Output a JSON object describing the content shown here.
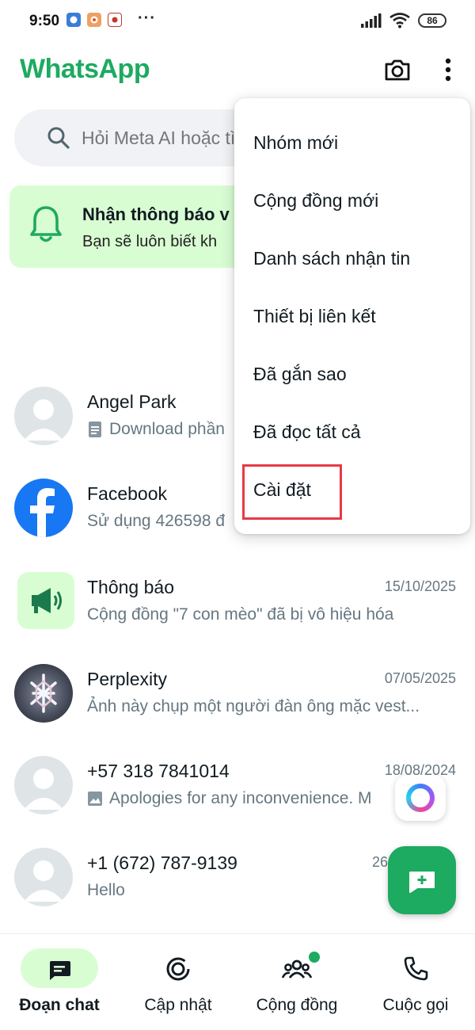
{
  "status_bar": {
    "time": "9:50",
    "battery": "86",
    "more_dots": "···"
  },
  "header": {
    "title": "WhatsApp",
    "camera_icon": "camera-icon",
    "more_icon": "more-vertical-icon"
  },
  "search": {
    "placeholder": "Hỏi Meta AI hoặc tìm kiếm"
  },
  "notice": {
    "title": "Nhận thông báo v",
    "text": "Bạn sẽ luôn biết kh"
  },
  "chats": [
    {
      "name": "Angel Park",
      "preview": "Download phần",
      "date": "",
      "preview_icon": "document-icon",
      "avatar": "default-avatar"
    },
    {
      "name": "Facebook",
      "preview": "Sử dụng 426598 đ",
      "date": "",
      "preview_icon": "",
      "avatar": "facebook-logo"
    },
    {
      "name": "Thông báo",
      "preview": "Cộng đồng \"7 con mèo\" đã bị vô hiệu hóa",
      "date": "15/10/2025",
      "preview_icon": "",
      "avatar": "megaphone-avatar"
    },
    {
      "name": "Perplexity",
      "preview": "Ảnh này chụp một người đàn ông mặc vest...",
      "date": "07/05/2025",
      "preview_icon": "",
      "avatar": "perplexity-avatar"
    },
    {
      "name": "+57 318 7841014",
      "preview": "Apologies for any inconvenience. M",
      "date": "18/08/2024",
      "preview_icon": "image-icon",
      "avatar": "default-avatar"
    },
    {
      "name": "+1 (672) 787-9139",
      "preview": "Hello",
      "date": "26",
      "preview_icon": "",
      "avatar": "default-avatar"
    }
  ],
  "menu": {
    "items": [
      "Nhóm mới",
      "Cộng đồng mới",
      "Danh sách nhận tin",
      "Thiết bị liên kết",
      "Đã gắn sao",
      "Đã đọc tất cả",
      "Cài đặt"
    ],
    "highlighted": "Cài đặt",
    "highlight_color": "#e63946"
  },
  "bottom_nav": {
    "items": [
      {
        "label": "Đoạn chat",
        "icon": "chat-icon",
        "active": true
      },
      {
        "label": "Cập nhật",
        "icon": "status-icon",
        "active": false
      },
      {
        "label": "Cộng đồng",
        "icon": "community-icon",
        "active": false
      },
      {
        "label": "Cuộc gọi",
        "icon": "phone-icon",
        "active": false
      }
    ]
  },
  "colors": {
    "brand": "#1daa61",
    "banner_bg": "#d9fdd3",
    "search_bg": "#f0f2f5"
  }
}
